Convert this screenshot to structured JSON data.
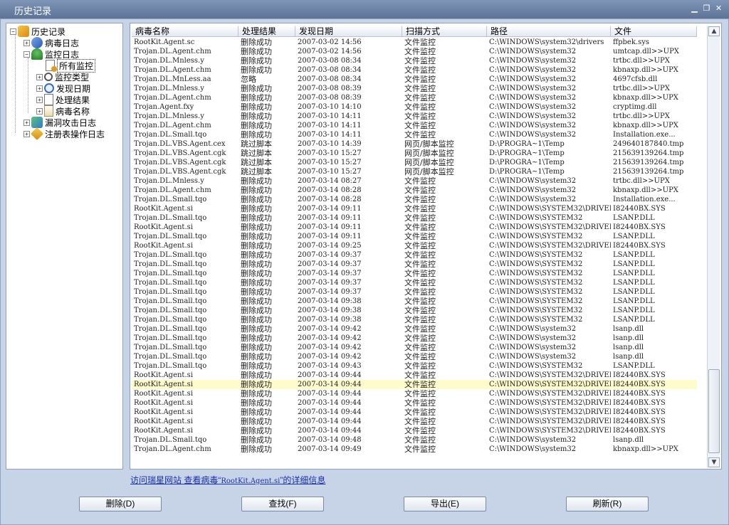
{
  "window": {
    "title": "历史记录",
    "controls": [
      "minimize",
      "restore",
      "close"
    ]
  },
  "tree": [
    {
      "label": "历史记录",
      "icon": "folder-icon",
      "expander": "⊟",
      "level": 0
    },
    {
      "label": "病毒日志",
      "icon": "virus-log-icon",
      "expander": "⊞",
      "level": 1
    },
    {
      "label": "监控日志",
      "icon": "monitor-log-icon",
      "expander": "⊟",
      "level": 1
    },
    {
      "label": "所有监控",
      "icon": "document-icon",
      "expander": "",
      "level": 2,
      "selected": true
    },
    {
      "label": "监控类型",
      "icon": "magnifier-icon",
      "expander": "⊞",
      "level": 2
    },
    {
      "label": "发现日期",
      "icon": "clock-icon",
      "expander": "⊞",
      "level": 2
    },
    {
      "label": "处理结果",
      "icon": "result-icon",
      "expander": "⊞",
      "level": 2
    },
    {
      "label": "病毒名称",
      "icon": "virus-name-icon",
      "expander": "⊞",
      "level": 2
    },
    {
      "label": "漏洞攻击日志",
      "icon": "vulnerability-icon",
      "expander": "⊞",
      "level": 1
    },
    {
      "label": "注册表操作日志",
      "icon": "registry-icon",
      "expander": "⊞",
      "level": 1
    }
  ],
  "table": {
    "columns": [
      "病毒名称",
      "处理结果",
      "发现日期",
      "扫描方式",
      "路径",
      "文件"
    ],
    "selected_row": 37,
    "rows": [
      [
        "RootKit.Agent.sc",
        "删除成功",
        "2007-03-02 14:56",
        "文件监控",
        "C:\\WINDOWS\\system32\\drivers",
        "ffpbek.sys"
      ],
      [
        "Trojan.DL.Agent.chm",
        "删除成功",
        "2007-03-02 14:56",
        "文件监控",
        "C:\\WINDOWS\\system32",
        "umtcap.dll>>UPX"
      ],
      [
        "Trojan.DL.Mnless.y",
        "删除成功",
        "2007-03-08 08:34",
        "文件监控",
        "C:\\WINDOWS\\system32",
        "trtbc.dll>>UPX"
      ],
      [
        "Trojan.DL.Agent.chm",
        "删除成功",
        "2007-03-08 08:34",
        "文件监控",
        "C:\\WINDOWS\\system32",
        "kbnaxp.dll>>UPX"
      ],
      [
        "Trojan.DL.MnLess.aa",
        "忽略",
        "2007-03-08 08:34",
        "文件监控",
        "C:\\WINDOWS\\system32",
        "4697cfsb.dll"
      ],
      [
        "Trojan.DL.Mnless.y",
        "删除成功",
        "2007-03-08 08:39",
        "文件监控",
        "C:\\WINDOWS\\system32",
        "trtbc.dll>>UPX"
      ],
      [
        "Trojan.DL.Agent.chm",
        "删除成功",
        "2007-03-08 08:39",
        "文件监控",
        "C:\\WINDOWS\\system32",
        "kbnaxp.dll>>UPX"
      ],
      [
        "Trojan.Agent.fxy",
        "删除成功",
        "2007-03-10 14:10",
        "文件监控",
        "C:\\WINDOWS\\system32",
        "cryptimg.dll"
      ],
      [
        "Trojan.DL.Mnless.y",
        "删除成功",
        "2007-03-10 14:11",
        "文件监控",
        "C:\\WINDOWS\\system32",
        "trtbc.dll>>UPX"
      ],
      [
        "Trojan.DL.Agent.chm",
        "删除成功",
        "2007-03-10 14:11",
        "文件监控",
        "C:\\WINDOWS\\system32",
        "kbnaxp.dll>>UPX"
      ],
      [
        "Trojan.DL.Small.tqo",
        "删除成功",
        "2007-03-10 14:11",
        "文件监控",
        "C:\\WINDOWS\\system32",
        "Installation.exe..."
      ],
      [
        "Trojan.DL.VBS.Agent.cex",
        "跳过脚本",
        "2007-03-10 14:39",
        "网页/脚本监控",
        "D:\\PROGRA~1\\Temp",
        "249640187840.tmp"
      ],
      [
        "Trojan.DL.VBS.Agent.cgk",
        "跳过脚本",
        "2007-03-10 15:27",
        "网页/脚本监控",
        "D:\\PROGRA~1\\Temp",
        "215639139264.tmp"
      ],
      [
        "Trojan.DL.VBS.Agent.cgk",
        "跳过脚本",
        "2007-03-10 15:27",
        "网页/脚本监控",
        "D:\\PROGRA~1\\Temp",
        "215639139264.tmp"
      ],
      [
        "Trojan.DL.VBS.Agent.cgk",
        "跳过脚本",
        "2007-03-10 15:27",
        "网页/脚本监控",
        "D:\\PROGRA~1\\Temp",
        "215639139264.tmp"
      ],
      [
        "Trojan.DL.Mnless.y",
        "删除成功",
        "2007-03-14 08:27",
        "文件监控",
        "C:\\WINDOWS\\system32",
        "trtbc.dll>>UPX"
      ],
      [
        "Trojan.DL.Agent.chm",
        "删除成功",
        "2007-03-14 08:28",
        "文件监控",
        "C:\\WINDOWS\\system32",
        "kbnaxp.dll>>UPX"
      ],
      [
        "Trojan.DL.Small.tqo",
        "删除成功",
        "2007-03-14 08:28",
        "文件监控",
        "C:\\WINDOWS\\system32",
        "Installation.exe..."
      ],
      [
        "RootKit.Agent.si",
        "删除成功",
        "2007-03-14 09:11",
        "文件监控",
        "C:\\WINDOWS\\SYSTEM32\\DRIVERS",
        "I82440BX.SYS"
      ],
      [
        "Trojan.DL.Small.tqo",
        "删除成功",
        "2007-03-14 09:11",
        "文件监控",
        "C:\\WINDOWS\\SYSTEM32",
        "LSANP.DLL"
      ],
      [
        "RootKit.Agent.si",
        "删除成功",
        "2007-03-14 09:11",
        "文件监控",
        "C:\\WINDOWS\\SYSTEM32\\DRIVERS",
        "I82440BX.SYS"
      ],
      [
        "Trojan.DL.Small.tqo",
        "删除成功",
        "2007-03-14 09:11",
        "文件监控",
        "C:\\WINDOWS\\SYSTEM32",
        "LSANP.DLL"
      ],
      [
        "RootKit.Agent.si",
        "删除成功",
        "2007-03-14 09:25",
        "文件监控",
        "C:\\WINDOWS\\SYSTEM32\\DRIVERS",
        "I82440BX.SYS"
      ],
      [
        "Trojan.DL.Small.tqo",
        "删除成功",
        "2007-03-14 09:37",
        "文件监控",
        "C:\\WINDOWS\\SYSTEM32",
        "LSANP.DLL"
      ],
      [
        "Trojan.DL.Small.tqo",
        "删除成功",
        "2007-03-14 09:37",
        "文件监控",
        "C:\\WINDOWS\\SYSTEM32",
        "LSANP.DLL"
      ],
      [
        "Trojan.DL.Small.tqo",
        "删除成功",
        "2007-03-14 09:37",
        "文件监控",
        "C:\\WINDOWS\\SYSTEM32",
        "LSANP.DLL"
      ],
      [
        "Trojan.DL.Small.tqo",
        "删除成功",
        "2007-03-14 09:37",
        "文件监控",
        "C:\\WINDOWS\\SYSTEM32",
        "LSANP.DLL"
      ],
      [
        "Trojan.DL.Small.tqo",
        "删除成功",
        "2007-03-14 09:37",
        "文件监控",
        "C:\\WINDOWS\\SYSTEM32",
        "LSANP.DLL"
      ],
      [
        "Trojan.DL.Small.tqo",
        "删除成功",
        "2007-03-14 09:38",
        "文件监控",
        "C:\\WINDOWS\\SYSTEM32",
        "LSANP.DLL"
      ],
      [
        "Trojan.DL.Small.tqo",
        "删除成功",
        "2007-03-14 09:38",
        "文件监控",
        "C:\\WINDOWS\\SYSTEM32",
        "LSANP.DLL"
      ],
      [
        "Trojan.DL.Small.tqo",
        "删除成功",
        "2007-03-14 09:38",
        "文件监控",
        "C:\\WINDOWS\\SYSTEM32",
        "LSANP.DLL"
      ],
      [
        "Trojan.DL.Small.tqo",
        "删除成功",
        "2007-03-14 09:42",
        "文件监控",
        "C:\\WINDOWS\\system32",
        "lsanp.dll"
      ],
      [
        "Trojan.DL.Small.tqo",
        "删除成功",
        "2007-03-14 09:42",
        "文件监控",
        "C:\\WINDOWS\\system32",
        "lsanp.dll"
      ],
      [
        "Trojan.DL.Small.tqo",
        "删除成功",
        "2007-03-14 09:42",
        "文件监控",
        "C:\\WINDOWS\\system32",
        "lsanp.dll"
      ],
      [
        "Trojan.DL.Small.tqo",
        "删除成功",
        "2007-03-14 09:42",
        "文件监控",
        "C:\\WINDOWS\\system32",
        "lsanp.dll"
      ],
      [
        "Trojan.DL.Small.tqo",
        "删除成功",
        "2007-03-14 09:43",
        "文件监控",
        "C:\\WINDOWS\\SYSTEM32",
        "LSANP.DLL"
      ],
      [
        "RootKit.Agent.si",
        "删除成功",
        "2007-03-14 09:44",
        "文件监控",
        "C:\\WINDOWS\\SYSTEM32\\DRIVERS",
        "I82440BX.SYS"
      ],
      [
        "RootKit.Agent.si",
        "删除成功",
        "2007-03-14 09:44",
        "文件监控",
        "C:\\WINDOWS\\SYSTEM32\\DRIVERS",
        "I82440BX.SYS"
      ],
      [
        "RootKit.Agent.si",
        "删除成功",
        "2007-03-14 09:44",
        "文件监控",
        "C:\\WINDOWS\\SYSTEM32\\DRIVERS",
        "I82440BX.SYS"
      ],
      [
        "RootKit.Agent.si",
        "删除成功",
        "2007-03-14 09:44",
        "文件监控",
        "C:\\WINDOWS\\SYSTEM32\\DRIVERS",
        "I82440BX.SYS"
      ],
      [
        "RootKit.Agent.si",
        "删除成功",
        "2007-03-14 09:44",
        "文件监控",
        "C:\\WINDOWS\\SYSTEM32\\DRIVERS",
        "I82440BX.SYS"
      ],
      [
        "RootKit.Agent.si",
        "删除成功",
        "2007-03-14 09:44",
        "文件监控",
        "C:\\WINDOWS\\SYSTEM32\\DRIVERS",
        "I82440BX.SYS"
      ],
      [
        "RootKit.Agent.si",
        "删除成功",
        "2007-03-14 09:44",
        "文件监控",
        "C:\\WINDOWS\\SYSTEM32\\DRIVERS",
        "I82440BX.SYS"
      ],
      [
        "Trojan.DL.Small.tqo",
        "删除成功",
        "2007-03-14 09:48",
        "文件监控",
        "C:\\WINDOWS\\system32",
        "lsanp.dll"
      ],
      [
        "Trojan.DL.Agent.chm",
        "删除成功",
        "2007-03-14 09:49",
        "文件监控",
        "C:\\WINDOWS\\system32",
        "kbnaxp.dll>>UPX"
      ]
    ]
  },
  "link": {
    "part1": "访问瑞星网站",
    "part2": "查看病毒“",
    "virus": "RootKit.Agent.si",
    "part3": "”的详细信息"
  },
  "buttons": {
    "delete": "删除(D)",
    "find": "查找(F)",
    "export": "导出(E)",
    "refresh": "刷新(R)"
  },
  "colors": {
    "selected_row": "#fffccb",
    "title_bar": "#6b82a8",
    "link": "#1a2fb0"
  }
}
